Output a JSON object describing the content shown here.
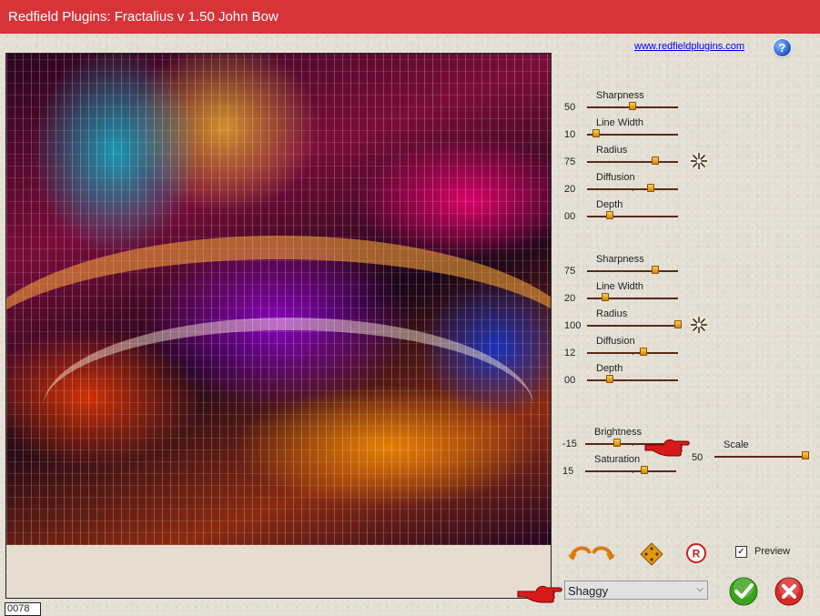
{
  "window": {
    "title": "Redfield Plugins: Fractalius v 1.50   John Bow"
  },
  "header": {
    "website_link": "www.redfieldplugins.com",
    "help_icon": "question-mark-icon",
    "help_glyph": "?"
  },
  "preview": {
    "frame_counter": "0078"
  },
  "group1": [
    {
      "label": "Sharpness",
      "value": "50",
      "level": 50
    },
    {
      "label": "Line Width",
      "value": "10",
      "level": 10
    },
    {
      "label": "Radius",
      "value": "75",
      "level": 75
    },
    {
      "label": "Diffusion",
      "value": "20",
      "level": 70
    },
    {
      "label": "Depth",
      "value": "00",
      "level": 25
    }
  ],
  "group2": [
    {
      "label": "Sharpness",
      "value": "75",
      "level": 75
    },
    {
      "label": "Line Width",
      "value": "20",
      "level": 20
    },
    {
      "label": "Radius",
      "value": "100",
      "level": 100
    },
    {
      "label": "Diffusion",
      "value": "12",
      "level": 62
    },
    {
      "label": "Depth",
      "value": "00",
      "level": 25
    }
  ],
  "adjust": [
    {
      "label": "Brightness",
      "value": "-15",
      "level": 35
    },
    {
      "label": "Saturation",
      "value": "15",
      "level": 65
    }
  ],
  "scale": {
    "label": "Scale",
    "value": "50",
    "level": 100
  },
  "controls": {
    "preview_label": "Preview",
    "preview_checked": true,
    "check_glyph": "✓",
    "preset_selected": "Shaggy",
    "dropdown_arrow": "⌵"
  },
  "colors": {
    "titlebar": "#d7343a",
    "accent_orange": "#e09a10",
    "ok_green": "#39a31a",
    "cancel_red": "#d82a2a"
  }
}
